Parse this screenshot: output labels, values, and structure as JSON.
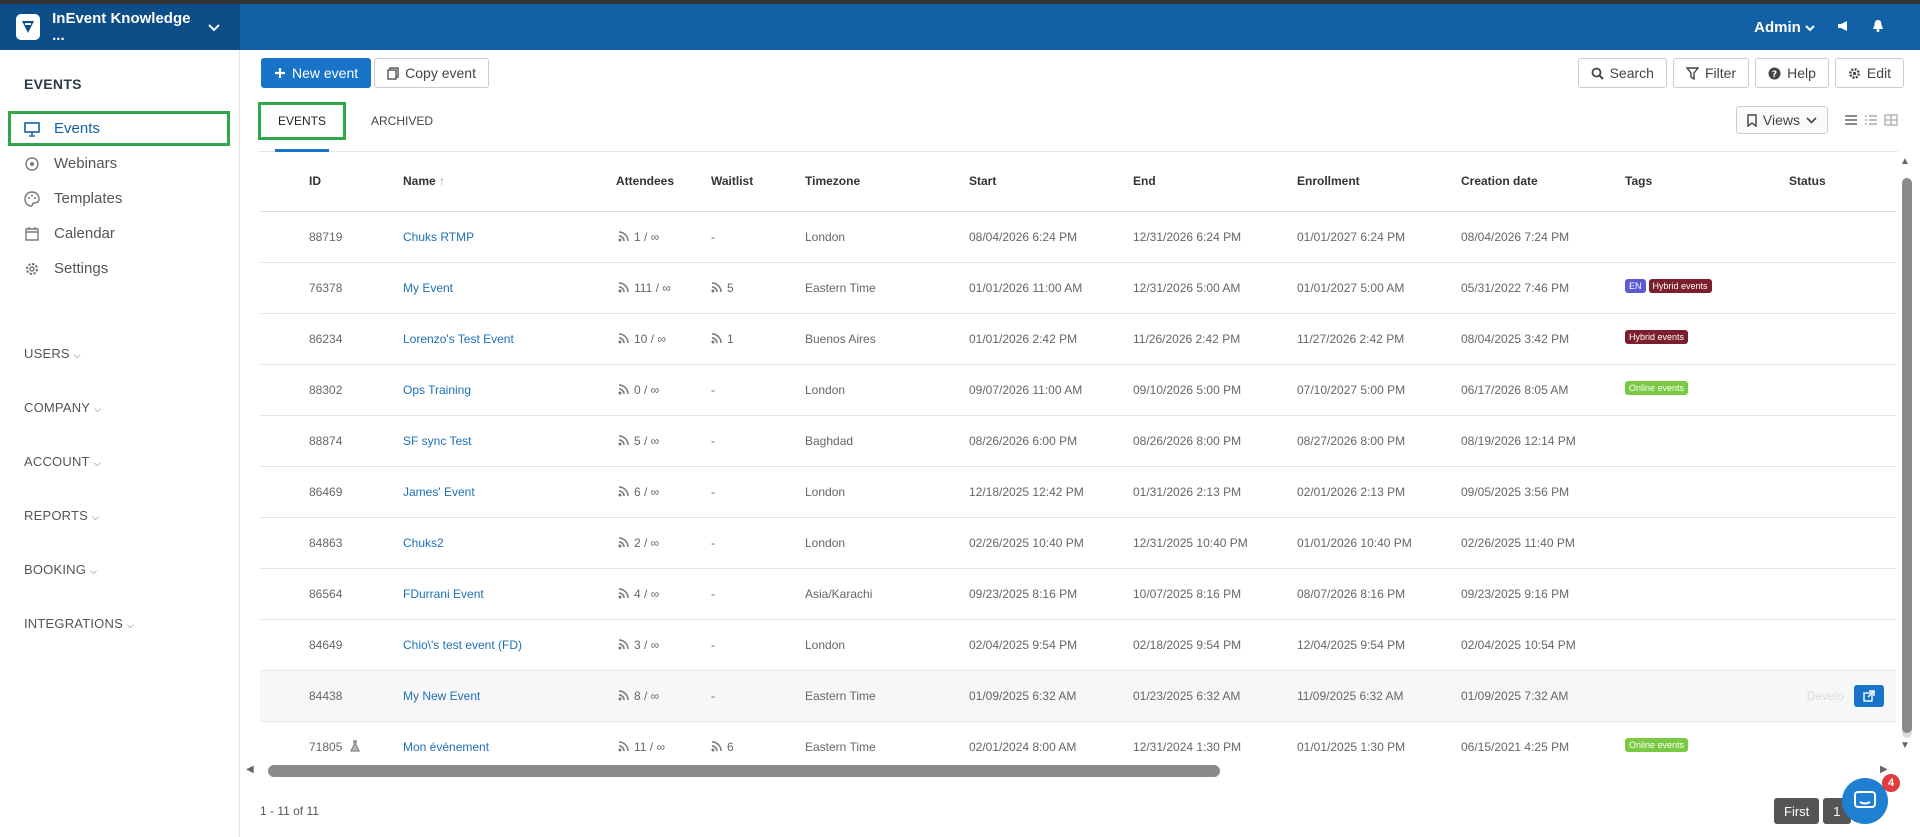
{
  "app": {
    "title": "InEvent Knowledge ...",
    "user": "Admin"
  },
  "sidebar": {
    "heading": "EVENTS",
    "items": [
      {
        "label": "Events",
        "icon": "presentation-icon",
        "active": true
      },
      {
        "label": "Webinars",
        "icon": "webinar-icon",
        "active": false
      },
      {
        "label": "Templates",
        "icon": "palette-icon",
        "active": false
      },
      {
        "label": "Calendar",
        "icon": "calendar-icon",
        "active": false
      },
      {
        "label": "Settings",
        "icon": "gear-icon",
        "active": false
      }
    ],
    "groups": [
      "USERS",
      "COMPANY",
      "ACCOUNT",
      "REPORTS",
      "BOOKING",
      "INTEGRATIONS"
    ]
  },
  "toolbar": {
    "new_event": "New event",
    "copy_event": "Copy event",
    "search": "Search",
    "filter": "Filter",
    "help": "Help",
    "edit": "Edit"
  },
  "tabs": {
    "events": "EVENTS",
    "archived": "ARCHIVED",
    "views": "Views"
  },
  "table": {
    "columns": [
      "ID",
      "Name",
      "Attendees",
      "Waitlist",
      "Timezone",
      "Start",
      "End",
      "Enrollment",
      "Creation date",
      "Tags",
      "Status"
    ],
    "rows": [
      {
        "id": "88719",
        "name": "Chuks RTMP",
        "attendees": "1 / ∞",
        "waitlist": "-",
        "timezone": "London",
        "start": "08/04/2026 6:24 PM",
        "end": "12/31/2026 6:24 PM",
        "enrollment": "01/01/2027 6:24 PM",
        "created": "08/04/2026 7:24 PM"
      },
      {
        "id": "76378",
        "name": "My Event",
        "attendees": "111 / ∞",
        "waitlist": "5",
        "timezone": "Eastern Time",
        "start": "01/01/2026 11:00 AM",
        "end": "12/31/2026 5:00 AM",
        "enrollment": "01/01/2027 5:00 AM",
        "created": "05/31/2022 7:46 PM",
        "tag1": "EN",
        "tag2": "Hybrid events"
      },
      {
        "id": "86234",
        "name": "Lorenzo's Test Event",
        "attendees": "10 / ∞",
        "waitlist": "1",
        "timezone": "Buenos Aires",
        "start": "01/01/2026 2:42 PM",
        "end": "11/26/2026 2:42 PM",
        "enrollment": "11/27/2026 2:42 PM",
        "created": "08/04/2025 3:42 PM",
        "tag1": "Hybrid events"
      },
      {
        "id": "88302",
        "name": "Ops Training",
        "attendees": "0 / ∞",
        "waitlist": "-",
        "timezone": "London",
        "start": "09/07/2026 11:00 AM",
        "end": "09/10/2026 5:00 PM",
        "enrollment": "07/10/2027 5:00 PM",
        "created": "06/17/2026 8:05 AM",
        "tag1": "Online events"
      },
      {
        "id": "88874",
        "name": "SF sync Test",
        "attendees": "5 / ∞",
        "waitlist": "-",
        "timezone": "Baghdad",
        "start": "08/26/2026 6:00 PM",
        "end": "08/26/2026 8:00 PM",
        "enrollment": "08/27/2026 8:00 PM",
        "created": "08/19/2026 12:14 PM"
      },
      {
        "id": "86469",
        "name": "James' Event",
        "attendees": "6 / ∞",
        "waitlist": "-",
        "timezone": "London",
        "start": "12/18/2025 12:42 PM",
        "end": "01/31/2026 2:13 PM",
        "enrollment": "02/01/2026 2:13 PM",
        "created": "09/05/2025 3:56 PM"
      },
      {
        "id": "84863",
        "name": "Chuks2",
        "attendees": "2 / ∞",
        "waitlist": "-",
        "timezone": "London",
        "start": "02/26/2025 10:40 PM",
        "end": "12/31/2025 10:40 PM",
        "enrollment": "01/01/2026 10:40 PM",
        "created": "02/26/2025 11:40 PM"
      },
      {
        "id": "86564",
        "name": "FDurrani Event",
        "attendees": "4 / ∞",
        "waitlist": "-",
        "timezone": "Asia/Karachi",
        "start": "09/23/2025 8:16 PM",
        "end": "10/07/2025 8:16 PM",
        "enrollment": "08/07/2026 8:16 PM",
        "created": "09/23/2025 9:16 PM"
      },
      {
        "id": "84649",
        "name": "Chio\\'s test event (FD)",
        "attendees": "3 / ∞",
        "waitlist": "-",
        "timezone": "London",
        "start": "02/04/2025 9:54 PM",
        "end": "02/18/2025 9:54 PM",
        "enrollment": "12/04/2025 9:54 PM",
        "created": "02/04/2025 10:54 PM"
      },
      {
        "id": "84438",
        "name": "My New Event",
        "attendees": "8 / ∞",
        "waitlist": "-",
        "timezone": "Eastern Time",
        "start": "01/09/2025 6:32 AM",
        "end": "01/23/2025 6:32 AM",
        "enrollment": "11/09/2025 6:32 AM",
        "created": "01/09/2025 7:32 AM",
        "status": "Develo"
      },
      {
        "id": "71805",
        "name": "Mon événement",
        "attendees": "11 / ∞",
        "waitlist": "6",
        "timezone": "Eastern Time",
        "start": "02/01/2024 8:00 AM",
        "end": "12/31/2024 1:30 PM",
        "enrollment": "01/01/2025 1:30 PM",
        "created": "06/15/2021 4:25 PM",
        "tag1": "Online events"
      }
    ]
  },
  "footer": {
    "count": "1 - 11 of 11",
    "first": "First",
    "page": "1"
  },
  "chat": {
    "badge": "4"
  },
  "colors": {
    "topbar": "#1261a6",
    "brand_bg": "#0d4d88",
    "primary": "#1874c8",
    "highlight_box": "#2ea84a",
    "tag_en": "#5b5bd6",
    "tag_hybrid": "#7a1f2b",
    "tag_online": "#7ac943"
  }
}
